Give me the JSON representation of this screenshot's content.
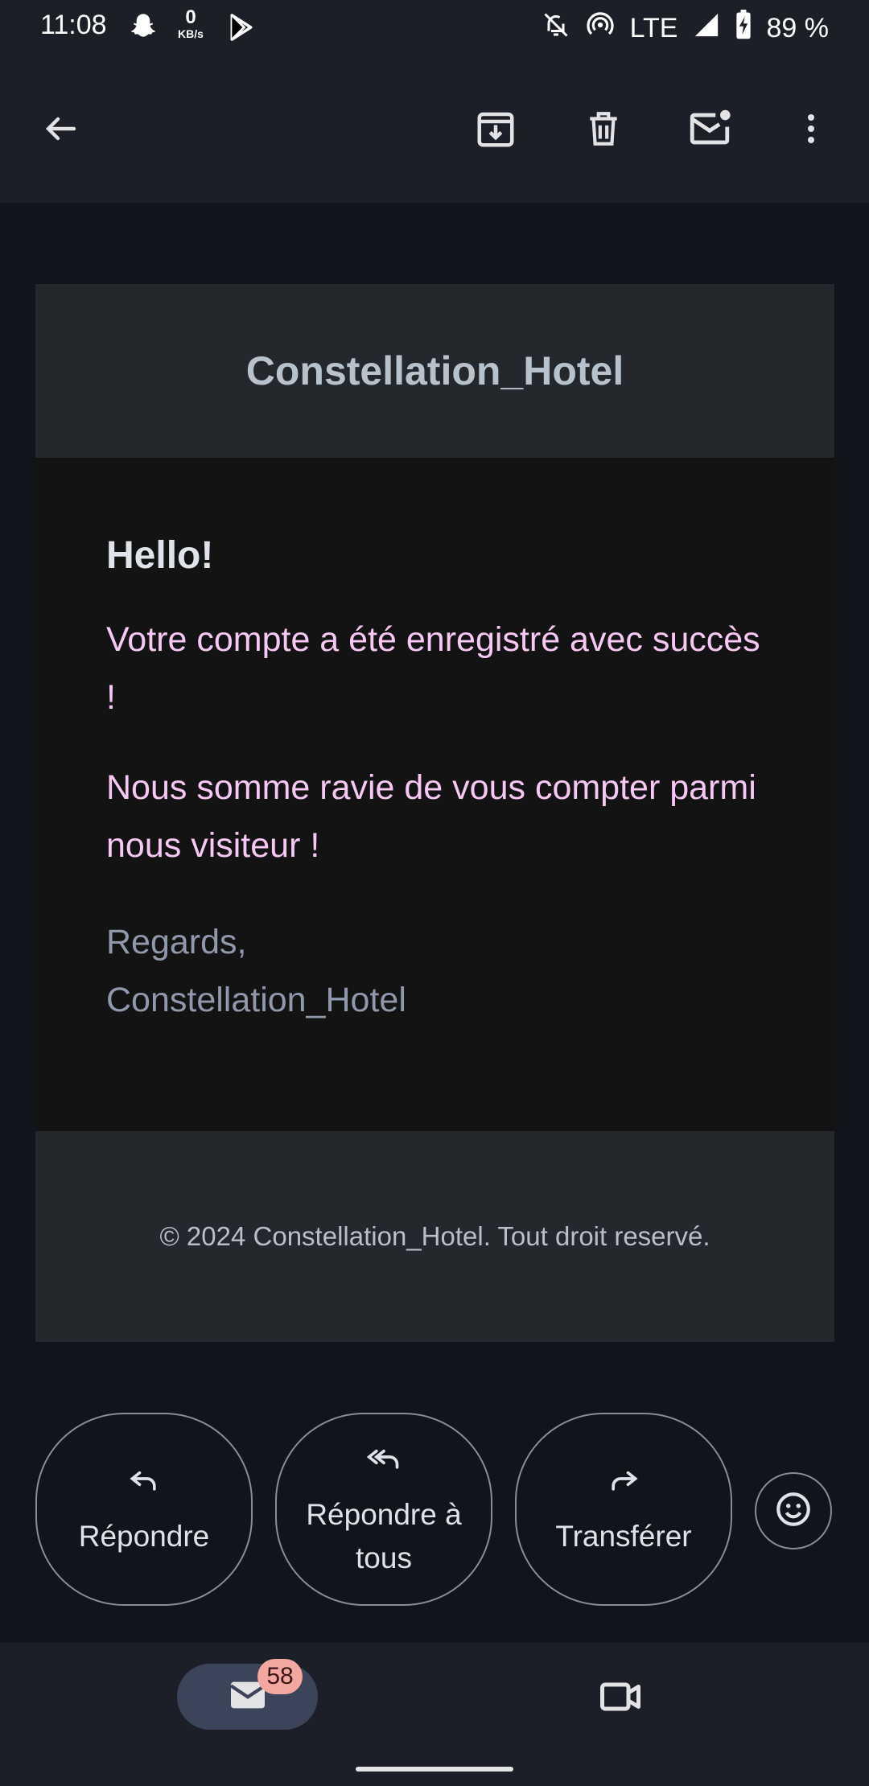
{
  "status_bar": {
    "time": "11:08",
    "speed_value": "0",
    "speed_unit": "KB/s",
    "network": "LTE",
    "battery": "89 %"
  },
  "app_bar": {
    "icons": [
      "back-arrow-icon",
      "archive-icon",
      "delete-icon",
      "mark-unread-icon",
      "more-vert-icon"
    ]
  },
  "email": {
    "header_title": "Constellation_Hotel",
    "greeting": "Hello!",
    "paragraph1": "Votre compte a été enregistré avec succès !",
    "paragraph2": "Nous somme ravie de vous compter parmi nous visiteur !",
    "regards_line1": "Regards,",
    "regards_line2": "Constellation_Hotel",
    "footer": "© 2024 Constellation_Hotel. Tout droit reservé."
  },
  "actions": {
    "reply": "Répondre",
    "reply_all_line1": "Répondre à",
    "reply_all_line2": "tous",
    "forward": "Transférer"
  },
  "bottom_nav": {
    "mail_badge": "58"
  },
  "colors": {
    "background": "#11141b",
    "bar": "#1c1f27",
    "accent_text": "#f7c8f3",
    "badge": "#f4a7a0"
  }
}
